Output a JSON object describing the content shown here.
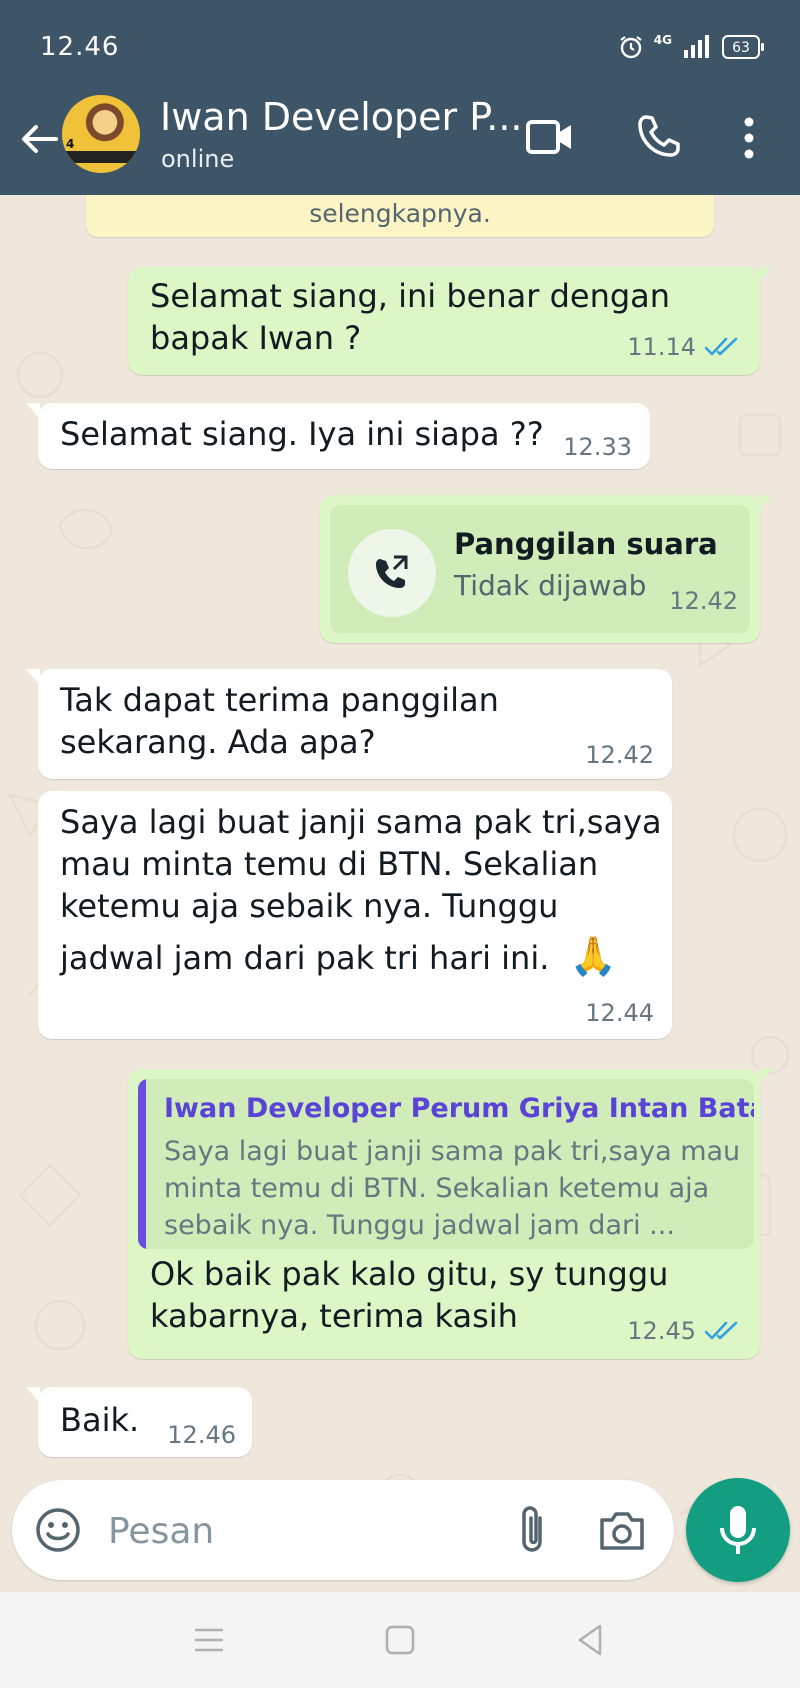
{
  "status_bar": {
    "time": "12.46",
    "network": "4G",
    "battery": "63"
  },
  "header": {
    "name": "Iwan Developer P...",
    "status": "online"
  },
  "notice": {
    "text": "selengkapnya."
  },
  "messages": [
    {
      "lines": [
        "Selamat siang, ini benar dengan",
        "bapak Iwan ?"
      ],
      "time": "11.14"
    },
    {
      "lines": [
        "Selamat siang. Iya ini siapa ??"
      ],
      "time": "12.33"
    },
    {
      "title": "Panggilan suara",
      "subtitle": "Tidak dijawab",
      "time": "12.42"
    },
    {
      "lines": [
        "Tak dapat terima panggilan",
        "sekarang. Ada apa?"
      ],
      "time": "12.42"
    },
    {
      "lines": [
        "Saya lagi buat janji sama pak tri,saya",
        "mau minta temu di BTN. Sekalian",
        "ketemu aja sebaik nya. Tunggu",
        "jadwal jam dari pak tri hari ini."
      ],
      "emoji": "🙏",
      "time": "12.44"
    },
    {
      "quote_author": "Iwan Developer Perum Griya Intan Bata...",
      "quote_text": "Saya lagi buat janji sama pak tri,saya mau minta temu di BTN. Sekalian ketemu aja sebaik nya. Tunggu jadwal jam dari ...",
      "lines": [
        "Ok baik pak kalo gitu, sy tunggu",
        "kabarnya, terima kasih"
      ],
      "time": "12.45"
    },
    {
      "lines": [
        "Baik."
      ],
      "time": "12.46"
    }
  ],
  "composer": {
    "placeholder": "Pesan"
  },
  "colors": {
    "header": "#3d5566",
    "outgoing": "#dcf7c5",
    "incoming": "#ffffff",
    "accent": "#139e82",
    "read_ticks": "#34a0e4",
    "wallpaper": "#efe7dc"
  },
  "icons": [
    "back-arrow-icon",
    "video-call-icon",
    "phone-icon",
    "more-vert-icon",
    "missed-call-icon",
    "emoji-icon",
    "paperclip-icon",
    "camera-icon",
    "mic-icon",
    "alarm-icon",
    "signal-icon",
    "battery-icon"
  ]
}
